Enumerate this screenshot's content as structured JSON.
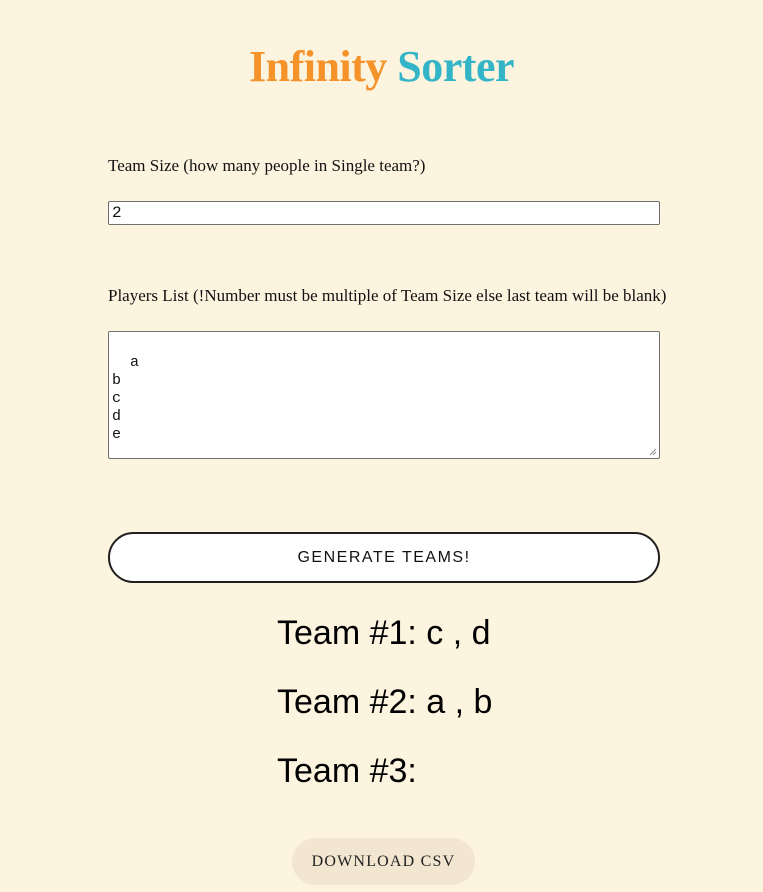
{
  "app": {
    "title_part1": "Infinity",
    "title_part2": "Sorter"
  },
  "form": {
    "team_size_label": "Team Size (how many people in Single team?)",
    "team_size_value": "2",
    "players_label": "Players List (!Number must be multiple of Team Size else last team will be blank)",
    "players_value": "a\nb\nc\nd\ne",
    "generate_label": "GENERATE TEAMS!"
  },
  "results": {
    "teams": [
      {
        "text": "Team #1: c , d"
      },
      {
        "text": "Team #2: a , b"
      },
      {
        "text": "Team #3:"
      }
    ]
  },
  "actions": {
    "download_label": "DOWNLOAD CSV"
  },
  "colors": {
    "background": "#fdf4df",
    "title_orange": "#f5922a",
    "title_teal": "#33b5c7",
    "download_bg": "#f2e6d1"
  },
  "icons": {
    "textarea_resize": "resize-grip-icon"
  }
}
